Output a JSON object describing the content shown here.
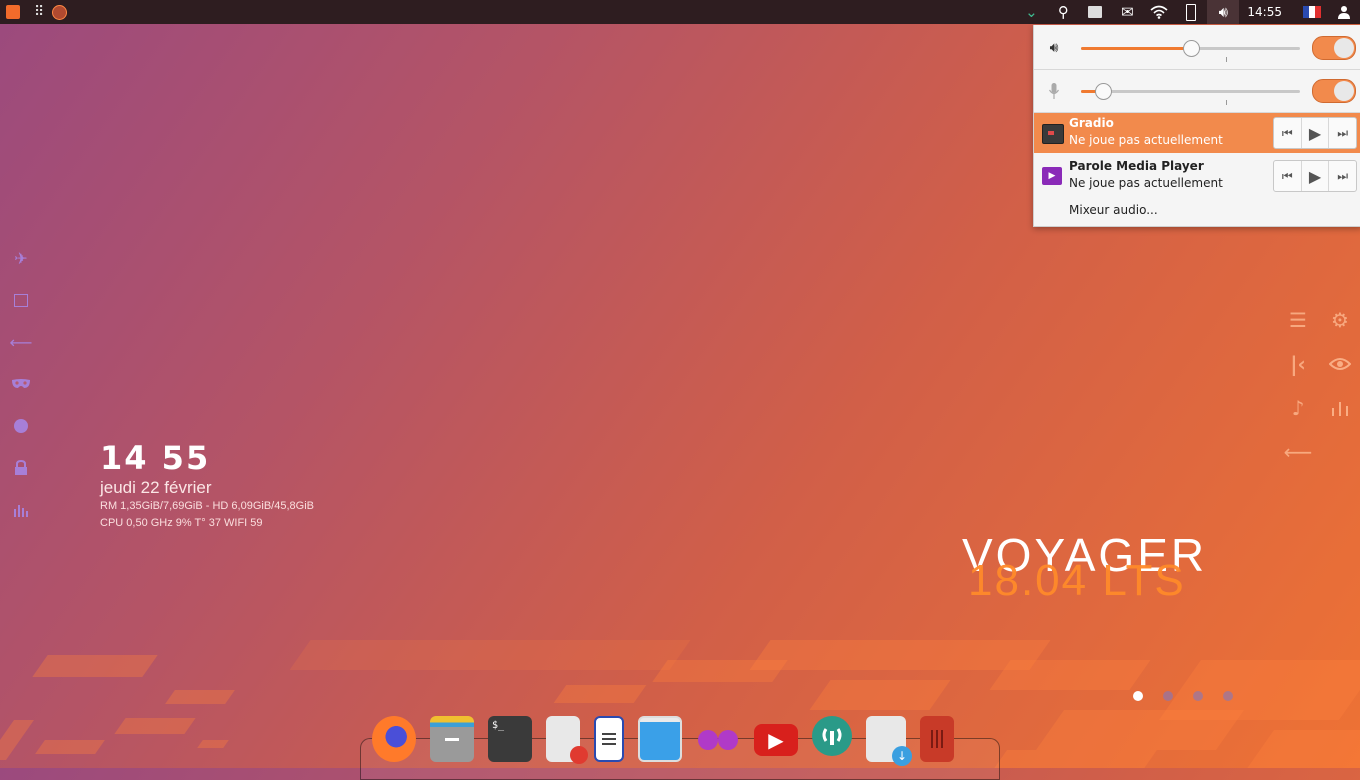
{
  "topbar": {
    "clock": "14:55",
    "icons": [
      "app-menu-icon",
      "apps-grid-icon",
      "firefox-icon",
      "chevron-down-icon",
      "search-icon",
      "notes-icon",
      "mail-icon",
      "wifi-icon",
      "battery-icon",
      "volume-icon",
      "flag-fr-icon",
      "user-icon"
    ]
  },
  "clock_widget": {
    "time": "14 55",
    "date": "jeudi 22 février",
    "mem_line": "RM 1,35GiB/7,69GiB - HD 6,09GiB/45,8GiB",
    "cpu_line": "CPU 0,50 GHz 9% T° 37  WIFI 59"
  },
  "branding": {
    "name": "VOYAGER",
    "version": "18.04 LTS"
  },
  "left_sidebar": [
    "airplane-icon",
    "window-icon",
    "arrow-left-icon",
    "mask-icon",
    "globe-icon",
    "lock-icon",
    "chart-icon"
  ],
  "right_widgets": [
    "menu-icon",
    "settings-gear-icon",
    "skip-back-icon",
    "eye-icon",
    "music-note-icon",
    "equalizer-icon",
    "arrow-left-icon"
  ],
  "workspace_dots": {
    "count": 4,
    "active_index": 0
  },
  "dock": [
    "Firefox",
    "Files",
    "Terminal",
    "Text Editor",
    "Writer",
    "Screenshot",
    "Gradio",
    "YouTube",
    "Update Manager",
    "Software Install",
    "Trash"
  ],
  "audio_popup": {
    "output_volume_fraction": 0.5,
    "input_volume_fraction": 0.1,
    "output_enabled": true,
    "input_enabled": true,
    "players": [
      {
        "name": "Gradio",
        "status": "Ne joue pas actuellement",
        "active": true
      },
      {
        "name": "Parole Media Player",
        "status": "Ne joue pas actuellement",
        "active": false
      }
    ],
    "mixer_label": "Mixeur audio..."
  },
  "colors": {
    "accent": "#f28a4c",
    "topbar_bg": "#2e1d20",
    "lts_orange": "#ff8a2a"
  }
}
